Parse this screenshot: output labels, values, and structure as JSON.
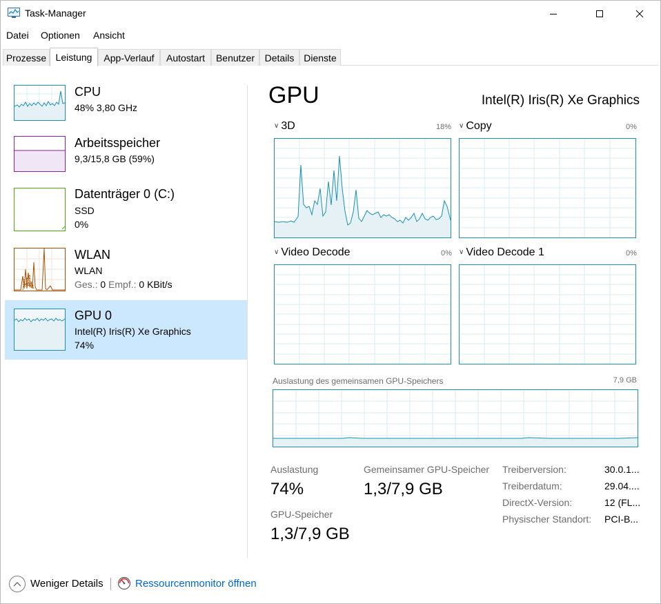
{
  "window": {
    "title": "Task-Manager"
  },
  "menu": [
    "Datei",
    "Optionen",
    "Ansicht"
  ],
  "tabs": [
    "Prozesse",
    "Leistung",
    "App-Verlauf",
    "Autostart",
    "Benutzer",
    "Details",
    "Dienste"
  ],
  "active_tab": "Leistung",
  "sidebar": {
    "items": [
      {
        "name": "CPU",
        "line1": "48% 3,80 GHz",
        "color": "#1a8fb0"
      },
      {
        "name": "Arbeitsspeicher",
        "line1": "9,3/15,8 GB (59%)",
        "color": "#8b1fa5"
      },
      {
        "name": "Datenträger 0 (C:)",
        "line1": "SSD",
        "line2": "0%",
        "color": "#4da60c"
      },
      {
        "name": "WLAN",
        "line1": "WLAN",
        "send_label": "Ges.:",
        "send_value": "0",
        "recv_label": "Empf.:",
        "recv_value": "0 KBit/s",
        "color": "#a74f01"
      },
      {
        "name": "GPU 0",
        "line1": "Intel(R) Iris(R) Xe Graphics",
        "line2": "74%",
        "color": "#1a8fb0"
      }
    ],
    "selected": "GPU 0"
  },
  "main": {
    "title": "GPU",
    "model": "Intel(R) Iris(R) Xe Graphics",
    "engines": [
      {
        "name": "3D",
        "percent": "18%"
      },
      {
        "name": "Copy",
        "percent": "0%"
      },
      {
        "name": "Video Decode",
        "percent": "0%"
      },
      {
        "name": "Video Decode 1",
        "percent": "0%"
      }
    ],
    "shared_memory": {
      "label": "Auslastung des gemeinsamen GPU-Speichers",
      "max": "7,9 GB"
    },
    "stats": {
      "utilization_label": "Auslastung",
      "utilization_value": "74%",
      "shared_label": "Gemeinsamer GPU-Speicher",
      "shared_value": "1,3/7,9 GB",
      "gpu_mem_label": "GPU-Speicher",
      "gpu_mem_value": "1,3/7,9 GB"
    },
    "info": [
      {
        "key": "Treiberversion:",
        "value": "30.0.1..."
      },
      {
        "key": "Treiberdatum:",
        "value": "29.04...."
      },
      {
        "key": "DirectX-Version:",
        "value": "12 (FL..."
      },
      {
        "key": "Physischer Standort:",
        "value": "PCI-B..."
      }
    ]
  },
  "footer": {
    "fewer_details": "Weniger Details",
    "resource_monitor": "Ressourcenmonitor öffnen"
  },
  "colors": {
    "accent": "#1a8fb0",
    "selected_bg": "#cce8ff",
    "link": "#0066cc"
  }
}
